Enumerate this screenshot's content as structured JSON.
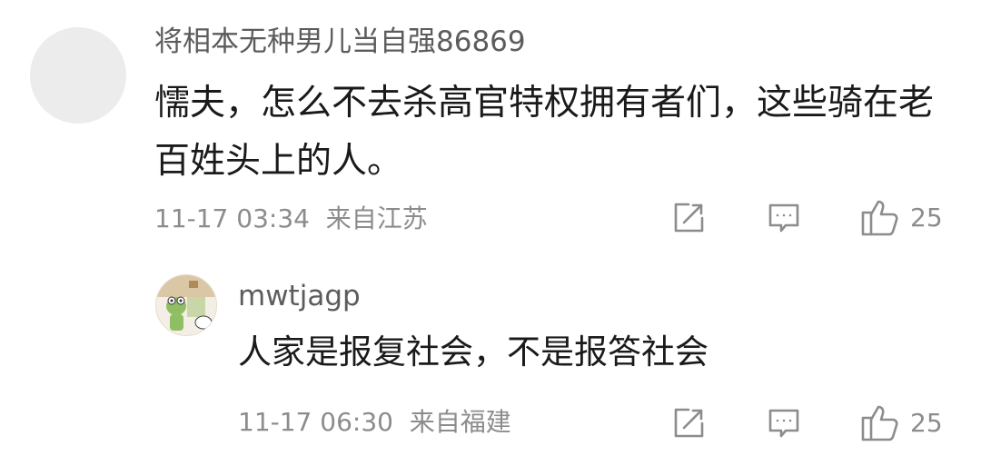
{
  "comments": [
    {
      "username": "将相本无种男儿当自强86869",
      "content": "懦夫，怎么不去杀高官特权拥有者们，这些骑在老百姓头上的人。",
      "date": "11-17 03:34",
      "location": "来自江苏",
      "likes": "25"
    },
    {
      "username": "mwtjagp",
      "content": "人家是报复社会，不是报答社会",
      "date": "11-17 06:30",
      "location": "来自福建",
      "likes": "25"
    }
  ],
  "icons": {
    "share": "share-icon",
    "reply": "reply-icon",
    "like": "thumbs-up-icon"
  },
  "colors": {
    "text": "#1a1a1a",
    "username": "#5c5c5c",
    "meta": "#8c8c8c",
    "avatar_placeholder": "#ececec"
  }
}
